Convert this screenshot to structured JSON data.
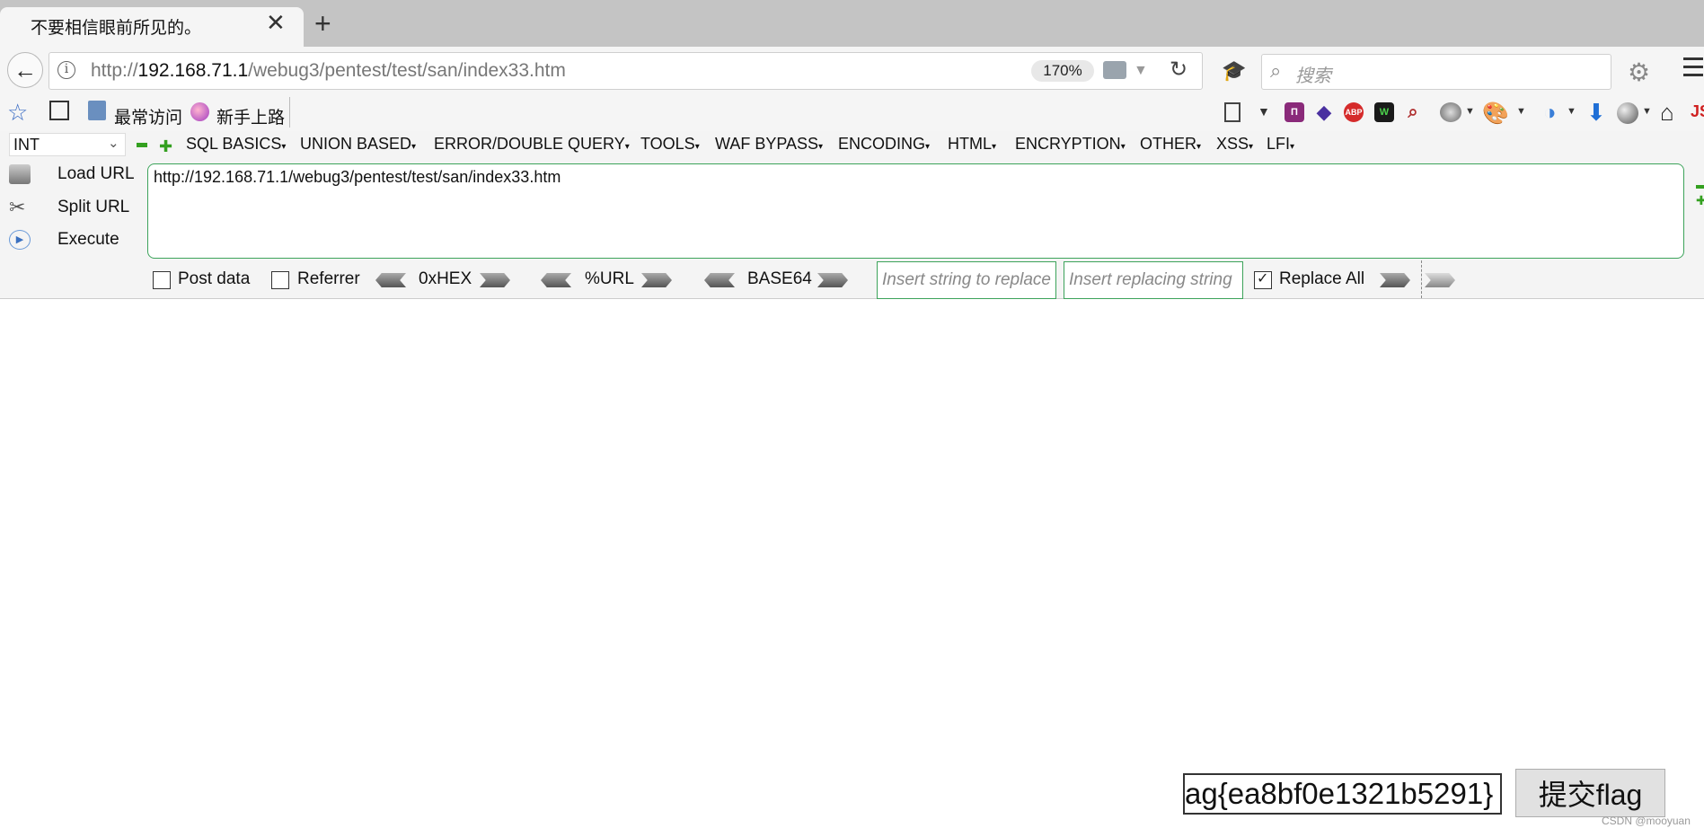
{
  "tab": {
    "title": "不要相信眼前所见的。",
    "close_glyph": "✕",
    "new_tab_glyph": "+"
  },
  "nav": {
    "back_glyph": "←",
    "url_prefix": "http://",
    "url_host": "192.168.71.1",
    "url_path": "/webug3/pentest/test/san/index33.htm",
    "zoom": "170%",
    "reload_glyph": "↻",
    "search_placeholder": "搜索"
  },
  "bookmarks": [
    {
      "label": "最常访问",
      "icon": "most-visited-icon"
    },
    {
      "label": "新手上路",
      "icon": "firefox-icon"
    }
  ],
  "extensions": [
    {
      "name": "lastpass-ext-icon",
      "text": "П",
      "color": "#8a2a7a"
    },
    {
      "name": "layers-ext-icon",
      "text": "◆",
      "color": "#4a30a0"
    },
    {
      "name": "abp-ext-icon",
      "text": "ABP",
      "color": "#d52b2b"
    },
    {
      "name": "shield-ext-icon",
      "text": "W",
      "color": "#1a1a1a"
    },
    {
      "name": "hackbar-search-ext-icon",
      "text": "⌕",
      "color": "#d0d0d0"
    }
  ],
  "hackbar": {
    "type_select": "INT",
    "menus": [
      "SQL BASICS",
      "UNION BASED",
      "ERROR/DOUBLE QUERY",
      "TOOLS",
      "WAF BYPASS",
      "ENCODING",
      "HTML",
      "ENCRYPTION",
      "OTHER",
      "XSS",
      "LFI"
    ],
    "buttons": {
      "load": "Load URL",
      "split": "Split URL",
      "execute": "Execute"
    },
    "url_value": "http://192.168.71.1/webug3/pentest/test/san/index33.htm",
    "post_data": "Post data",
    "referrer": "Referrer",
    "hex": "0xHEX",
    "urlenc": "%URL",
    "base64": "BASE64",
    "replace_from_placeholder": "Insert string to replace",
    "replace_to_placeholder": "Insert replacing string",
    "replace_all": "Replace All",
    "replace_all_checked": true
  },
  "page": {
    "flag_value": "ag{ea8bf0e1321b5291}",
    "submit_label": "提交flag",
    "watermark": "CSDN @mooyuan"
  }
}
